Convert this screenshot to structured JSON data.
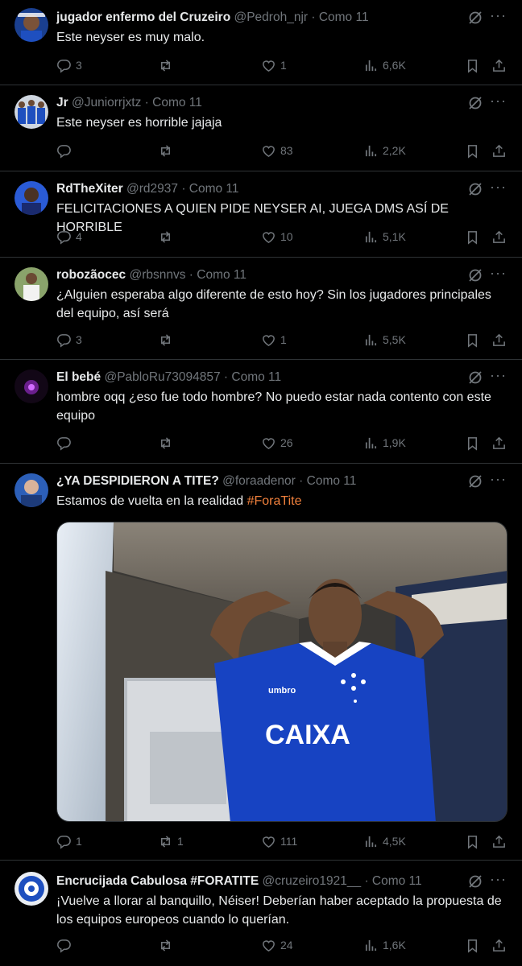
{
  "tweets": [
    {
      "name": "jugador enfermo del Cruzeiro",
      "handle": "@Pedroh_njr",
      "time": "· Como 11",
      "text": "Este neyser es muy malo.",
      "replies": "3",
      "reposts": "",
      "likes": "1",
      "views": "6,6K"
    },
    {
      "name": "Jr",
      "handle": "@Juniorrjxtz",
      "time": "· Como 11",
      "text": "Este neyser es horrible jajaja",
      "replies": "",
      "reposts": "",
      "likes": "83",
      "views": "2,2K"
    },
    {
      "name": "RdTheXiter",
      "handle": "@rd2937",
      "time": "· Como 11",
      "text": "FELICITACIONES A QUIEN PIDE NEYSER AI, JUEGA DMS ASÍ DE HORRIBLE",
      "replies": "4",
      "reposts": "",
      "likes": "10",
      "views": "5,1K"
    },
    {
      "name": "robozãocec",
      "handle": "@rbsnnvs",
      "time": "· Como 11",
      "text": "¿Alguien esperaba algo diferente de esto hoy? Sin los jugadores principales del equipo, así será",
      "replies": "3",
      "reposts": "",
      "likes": "1",
      "views": "5,5K"
    },
    {
      "name": "El bebé",
      "handle": "@PabloRu73094857",
      "time": "· Como 11",
      "text": "hombre oqq ¿eso fue todo hombre? No puedo estar nada contento con este equipo",
      "replies": "",
      "reposts": "",
      "likes": "26",
      "views": "1,9K"
    },
    {
      "name": "¿YA DESPIDIERON A TITE?",
      "handle": "@foraadenor",
      "time": "· Como 11",
      "text": "Estamos de vuelta en la realidad ",
      "hashtag": "#ForaTite",
      "replies": "1",
      "reposts": "1",
      "likes": "111",
      "views": "4,5K",
      "media": {
        "brand_left": "umbro",
        "sponsor": "CAIXA"
      }
    },
    {
      "name": "Encrucijada Cabulosa #FORATITE",
      "handle": "@cruzeiro1921__",
      "time": "· Como 11",
      "text": "¡Vuelve a llorar al banquillo, Néiser! Deberían haber aceptado la propuesta de los equipos europeos cuando lo querían.",
      "replies": "",
      "reposts": "",
      "likes": "24",
      "views": "1,6K"
    }
  ],
  "colors": {
    "background": "#000000",
    "text": "#e7e9ea",
    "muted": "#71767b",
    "hashtag": "#f0803c",
    "divider": "#2f3336"
  }
}
